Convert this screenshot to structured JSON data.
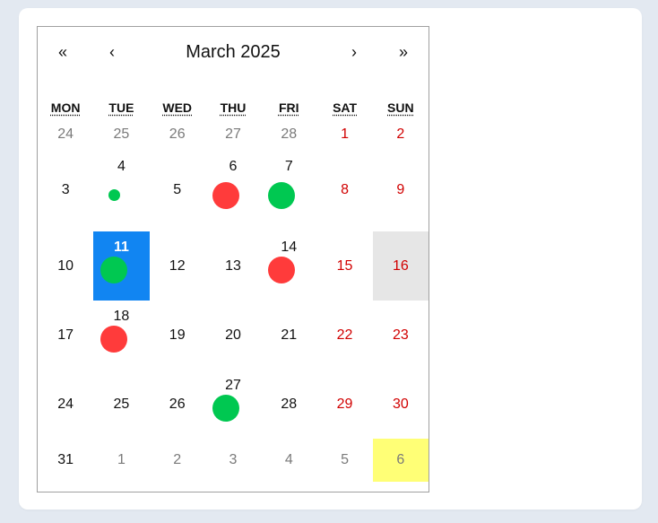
{
  "calendar": {
    "title": "March 2025",
    "nav": {
      "prev_year": "«",
      "prev_month": "‹",
      "next_month": "›",
      "next_year": "»"
    },
    "weekdays": [
      "MON",
      "TUE",
      "WED",
      "THU",
      "FRI",
      "SAT",
      "SUN"
    ],
    "colors": {
      "weekend": "#d10000",
      "other_month": "#7a7a7a",
      "selected": "#1185f2",
      "highlight_gray": "#e6e6e6",
      "highlight_yellow": "#ffff76",
      "event_red": "#ff3b3b",
      "event_green": "#00c851"
    },
    "weeks": [
      [
        {
          "label": "24",
          "other": true
        },
        {
          "label": "25",
          "other": true
        },
        {
          "label": "26",
          "other": true
        },
        {
          "label": "27",
          "other": true
        },
        {
          "label": "28",
          "other": true
        },
        {
          "label": "1",
          "weekend": true
        },
        {
          "label": "2",
          "weekend": true
        }
      ],
      [
        {
          "label": "3"
        },
        {
          "label": "4",
          "event": "green-small"
        },
        {
          "label": "5"
        },
        {
          "label": "6",
          "event": "red"
        },
        {
          "label": "7",
          "event": "green"
        },
        {
          "label": "8",
          "weekend": true
        },
        {
          "label": "9",
          "weekend": true
        }
      ],
      [
        {
          "label": "10"
        },
        {
          "label": "11",
          "selected": true,
          "event": "green"
        },
        {
          "label": "12"
        },
        {
          "label": "13"
        },
        {
          "label": "14",
          "event": "red"
        },
        {
          "label": "15",
          "weekend": true
        },
        {
          "label": "16",
          "weekend": true,
          "highlight": "gray"
        }
      ],
      [
        {
          "label": "17"
        },
        {
          "label": "18",
          "event": "red"
        },
        {
          "label": "19"
        },
        {
          "label": "20"
        },
        {
          "label": "21"
        },
        {
          "label": "22",
          "weekend": true
        },
        {
          "label": "23",
          "weekend": true
        }
      ],
      [
        {
          "label": "24"
        },
        {
          "label": "25"
        },
        {
          "label": "26"
        },
        {
          "label": "27",
          "event": "green"
        },
        {
          "label": "28"
        },
        {
          "label": "29",
          "weekend": true
        },
        {
          "label": "30",
          "weekend": true
        }
      ],
      [
        {
          "label": "31"
        },
        {
          "label": "1",
          "other": true
        },
        {
          "label": "2",
          "other": true
        },
        {
          "label": "3",
          "other": true
        },
        {
          "label": "4",
          "other": true
        },
        {
          "label": "5",
          "other": true,
          "weekend": true
        },
        {
          "label": "6",
          "other": true,
          "weekend": true,
          "highlight": "yellow"
        }
      ]
    ]
  }
}
